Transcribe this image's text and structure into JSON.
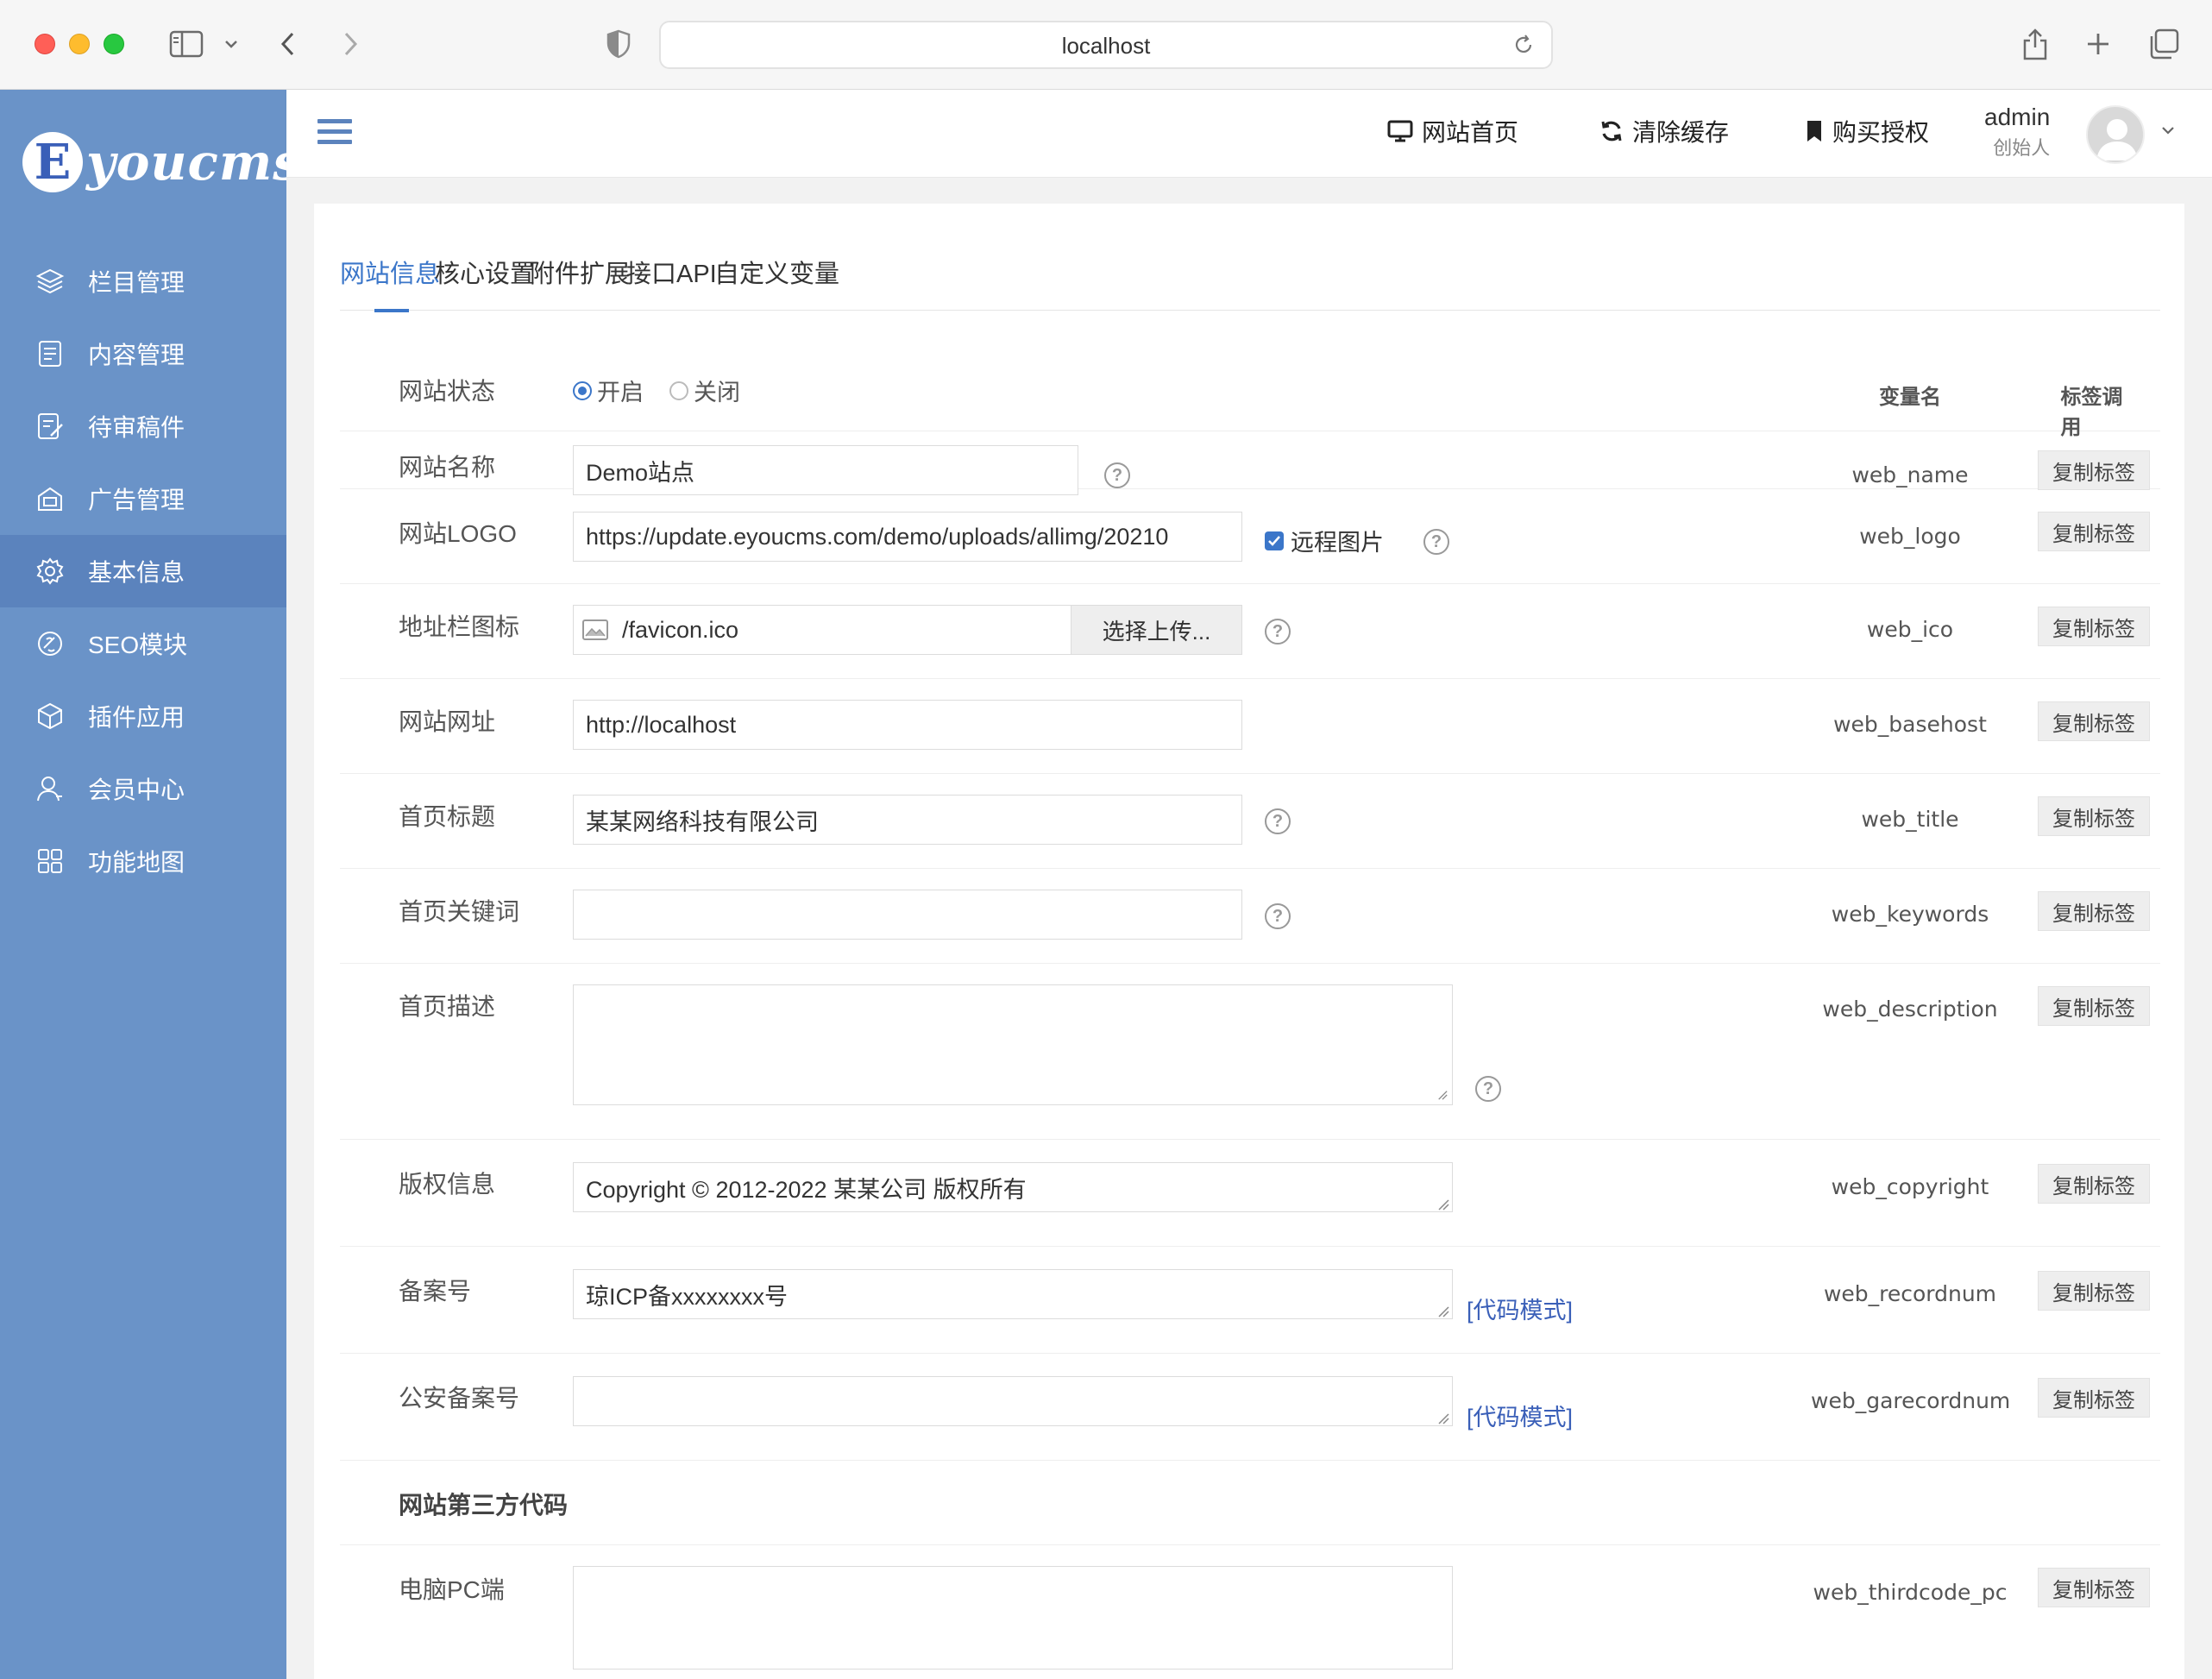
{
  "browser": {
    "url": "localhost"
  },
  "sidebar": {
    "logo_letter": "E",
    "logo_text": "youcms",
    "items": [
      {
        "label": "栏目管理",
        "icon": "layers-icon"
      },
      {
        "label": "内容管理",
        "icon": "document-icon"
      },
      {
        "label": "待审稿件",
        "icon": "edit-note-icon"
      },
      {
        "label": "广告管理",
        "icon": "ad-icon"
      },
      {
        "label": "基本信息",
        "icon": "gear-icon",
        "active": true
      },
      {
        "label": "SEO模块",
        "icon": "seo-icon"
      },
      {
        "label": "插件应用",
        "icon": "cube-icon"
      },
      {
        "label": "会员中心",
        "icon": "user-icon"
      },
      {
        "label": "功能地图",
        "icon": "grid-icon"
      }
    ]
  },
  "header": {
    "links": [
      {
        "label": "网站首页",
        "icon": "monitor-icon"
      },
      {
        "label": "清除缓存",
        "icon": "refresh-icon"
      },
      {
        "label": "购买授权",
        "icon": "bookmark-icon"
      }
    ],
    "user_name": "admin",
    "user_role": "创始人"
  },
  "tabs": [
    "网站信息",
    "核心设置",
    "附件扩展",
    "接口API",
    "自定义变量"
  ],
  "columns": {
    "var_name": "变量名",
    "tag_call": "标签调用"
  },
  "copy_label": "复制标签",
  "code_mode_label": "[代码模式]",
  "form": {
    "status": {
      "label": "网站状态",
      "on": "开启",
      "off": "关闭",
      "selected": "开启"
    },
    "name": {
      "label": "网站名称",
      "value": "Demo站点",
      "var": "web_name"
    },
    "logo": {
      "label": "网站LOGO",
      "value": "https://update.eyoucms.com/demo/uploads/allimg/20210",
      "remote_label": "远程图片",
      "remote_checked": true,
      "var": "web_logo"
    },
    "ico": {
      "label": "地址栏图标",
      "value": "/favicon.ico",
      "upload_label": "选择上传...",
      "var": "web_ico"
    },
    "basehost": {
      "label": "网站网址",
      "value": "http://localhost",
      "var": "web_basehost"
    },
    "title": {
      "label": "首页标题",
      "value": "某某网络科技有限公司",
      "var": "web_title"
    },
    "keywords": {
      "label": "首页关键词",
      "value": "",
      "var": "web_keywords"
    },
    "description": {
      "label": "首页描述",
      "value": "",
      "var": "web_description"
    },
    "copyright": {
      "label": "版权信息",
      "value": "Copyright © 2012-2022 某某公司 版权所有",
      "var": "web_copyright"
    },
    "recordnum": {
      "label": "备案号",
      "value": "琼ICP备xxxxxxxx号",
      "var": "web_recordnum"
    },
    "garecordnum": {
      "label": "公安备案号",
      "value": "",
      "var": "web_garecordnum"
    },
    "third_section": "网站第三方代码",
    "thirdcode_pc": {
      "label": "电脑PC端",
      "value": "",
      "var": "web_thirdcode_pc"
    }
  }
}
